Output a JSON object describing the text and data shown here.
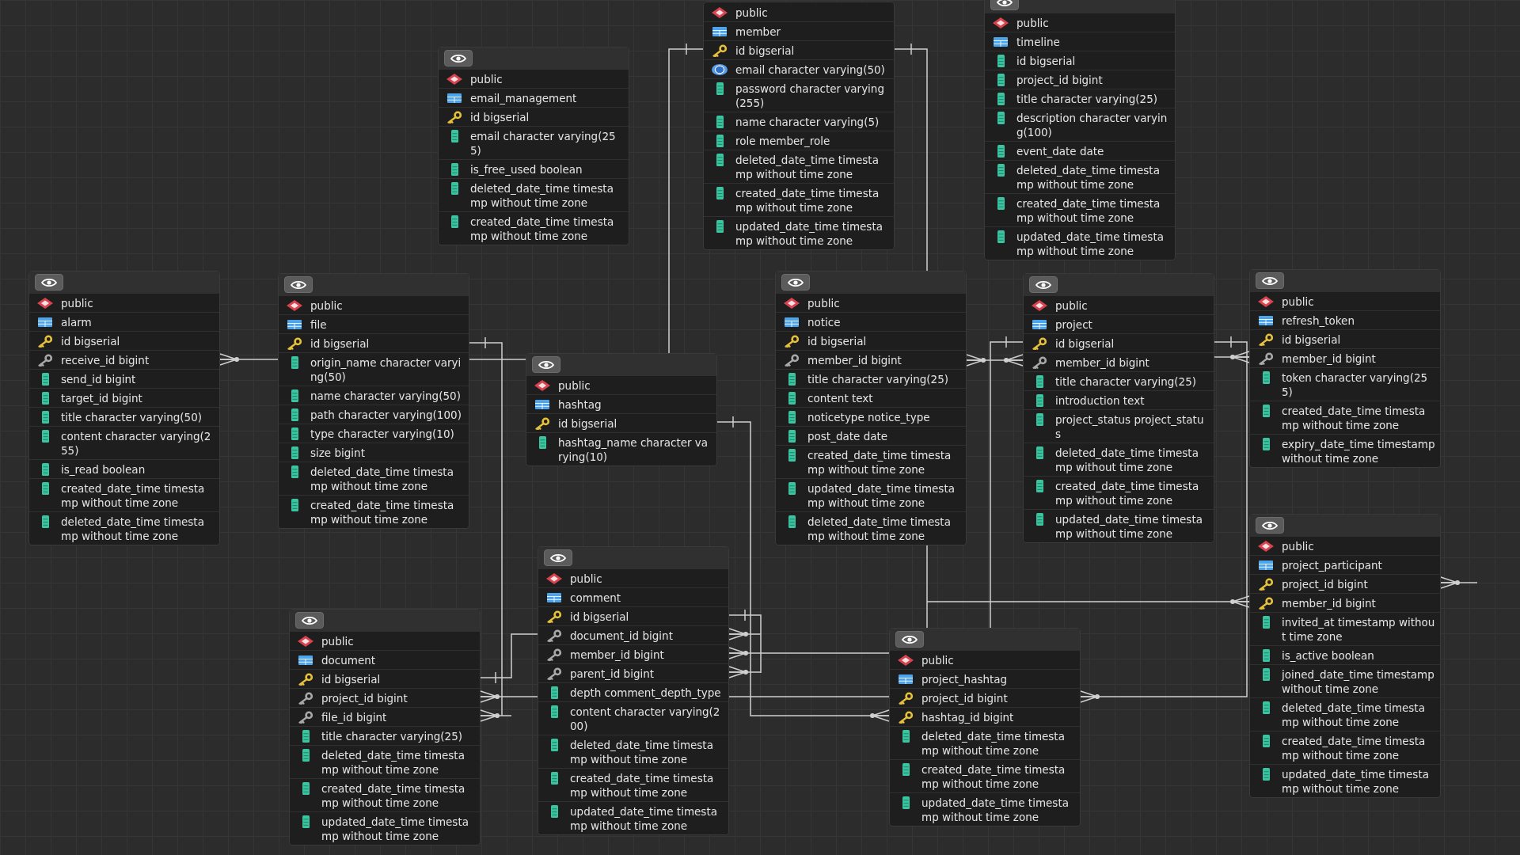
{
  "diagram": {
    "tables": [
      {
        "view_button": true,
        "schema": "public",
        "name": "email_management",
        "columns": [
          {
            "kind": "pk",
            "text": "id bigserial"
          },
          {
            "kind": "column",
            "text": "email character varying(255)"
          },
          {
            "kind": "column",
            "text": "is_free_used boolean"
          },
          {
            "kind": "column",
            "text": "deleted_date_time timestamp without time zone"
          },
          {
            "kind": "column",
            "text": "created_date_time timestamp without time zone"
          }
        ]
      },
      {
        "view_button": false,
        "schema": "public",
        "name": "member",
        "columns": [
          {
            "kind": "pk",
            "text": "id bigserial"
          },
          {
            "kind": "unique",
            "text": "email character varying(50)"
          },
          {
            "kind": "column",
            "text": "password character varying(255)"
          },
          {
            "kind": "column",
            "text": "name character varying(5)"
          },
          {
            "kind": "column",
            "text": "role member_role"
          },
          {
            "kind": "column",
            "text": "deleted_date_time timestamp without time zone"
          },
          {
            "kind": "column",
            "text": "created_date_time timestamp without time zone"
          },
          {
            "kind": "column",
            "text": "updated_date_time timestamp without time zone"
          }
        ]
      },
      {
        "view_button": true,
        "schema": "public",
        "name": "timeline",
        "columns": [
          {
            "kind": "column",
            "text": "id bigserial"
          },
          {
            "kind": "column",
            "text": "project_id bigint"
          },
          {
            "kind": "column",
            "text": "title character varying(25)"
          },
          {
            "kind": "column",
            "text": "description character varying(100)"
          },
          {
            "kind": "column",
            "text": "event_date date"
          },
          {
            "kind": "column",
            "text": "deleted_date_time timestamp without time zone"
          },
          {
            "kind": "column",
            "text": "created_date_time timestamp without time zone"
          },
          {
            "kind": "column",
            "text": "updated_date_time timestamp without time zone"
          }
        ]
      },
      {
        "view_button": true,
        "schema": "public",
        "name": "alarm",
        "columns": [
          {
            "kind": "pk",
            "text": "id bigserial"
          },
          {
            "kind": "fk",
            "text": "receive_id bigint"
          },
          {
            "kind": "column",
            "text": "send_id bigint"
          },
          {
            "kind": "column",
            "text": "target_id bigint"
          },
          {
            "kind": "column",
            "text": "title character varying(50)"
          },
          {
            "kind": "column",
            "text": "content character varying(255)"
          },
          {
            "kind": "column",
            "text": "is_read boolean"
          },
          {
            "kind": "column",
            "text": "created_date_time timestamp without time zone"
          },
          {
            "kind": "column",
            "text": "deleted_date_time timestamp without time zone"
          }
        ]
      },
      {
        "view_button": true,
        "schema": "public",
        "name": "file",
        "columns": [
          {
            "kind": "pk",
            "text": "id bigserial"
          },
          {
            "kind": "column",
            "text": "origin_name character varying(50)"
          },
          {
            "kind": "column",
            "text": "name character varying(50)"
          },
          {
            "kind": "column",
            "text": "path character varying(100)"
          },
          {
            "kind": "column",
            "text": "type character varying(10)"
          },
          {
            "kind": "column",
            "text": "size bigint"
          },
          {
            "kind": "column",
            "text": "deleted_date_time timestamp without time zone"
          },
          {
            "kind": "column",
            "text": "created_date_time timestamp without time zone"
          }
        ]
      },
      {
        "view_button": true,
        "schema": "public",
        "name": "hashtag",
        "columns": [
          {
            "kind": "pk",
            "text": "id bigserial"
          },
          {
            "kind": "column",
            "text": "hashtag_name character varying(10)"
          }
        ]
      },
      {
        "view_button": true,
        "schema": "public",
        "name": "notice",
        "columns": [
          {
            "kind": "pk",
            "text": "id bigserial"
          },
          {
            "kind": "fk",
            "text": "member_id bigint"
          },
          {
            "kind": "column",
            "text": "title character varying(25)"
          },
          {
            "kind": "column",
            "text": "content text"
          },
          {
            "kind": "column",
            "text": "noticetype notice_type"
          },
          {
            "kind": "column",
            "text": "post_date date"
          },
          {
            "kind": "column",
            "text": "created_date_time timestamp without time zone"
          },
          {
            "kind": "column",
            "text": "updated_date_time timestamp without time zone"
          },
          {
            "kind": "column",
            "text": "deleted_date_time timestamp without time zone"
          }
        ]
      },
      {
        "view_button": true,
        "schema": "public",
        "name": "project",
        "columns": [
          {
            "kind": "pk",
            "text": "id bigserial"
          },
          {
            "kind": "fk",
            "text": "member_id bigint"
          },
          {
            "kind": "column",
            "text": "title character varying(25)"
          },
          {
            "kind": "column",
            "text": "introduction text"
          },
          {
            "kind": "column",
            "text": "project_status project_status"
          },
          {
            "kind": "column",
            "text": "deleted_date_time timestamp without time zone"
          },
          {
            "kind": "column",
            "text": "created_date_time timestamp without time zone"
          },
          {
            "kind": "column",
            "text": "updated_date_time timestamp without time zone"
          }
        ]
      },
      {
        "view_button": true,
        "schema": "public",
        "name": "refresh_token",
        "columns": [
          {
            "kind": "pk",
            "text": "id bigserial"
          },
          {
            "kind": "fk",
            "text": "member_id bigint"
          },
          {
            "kind": "column",
            "text": "token character varying(255)"
          },
          {
            "kind": "column",
            "text": "created_date_time timestamp without time zone"
          },
          {
            "kind": "column",
            "text": "expiry_date_time timestamp without time zone"
          }
        ]
      },
      {
        "view_button": true,
        "schema": "public",
        "name": "document",
        "columns": [
          {
            "kind": "pk",
            "text": "id bigserial"
          },
          {
            "kind": "fk",
            "text": "project_id bigint"
          },
          {
            "kind": "fk",
            "text": "file_id bigint"
          },
          {
            "kind": "column",
            "text": "title character varying(25)"
          },
          {
            "kind": "column",
            "text": "deleted_date_time timestamp without time zone"
          },
          {
            "kind": "column",
            "text": "created_date_time timestamp without time zone"
          },
          {
            "kind": "column",
            "text": "updated_date_time timestamp without time zone"
          }
        ]
      },
      {
        "view_button": true,
        "schema": "public",
        "name": "comment",
        "columns": [
          {
            "kind": "pk",
            "text": "id bigserial"
          },
          {
            "kind": "fk",
            "text": "document_id bigint"
          },
          {
            "kind": "fk",
            "text": "member_id bigint"
          },
          {
            "kind": "fk",
            "text": "parent_id bigint"
          },
          {
            "kind": "column",
            "text": "depth comment_depth_type"
          },
          {
            "kind": "column",
            "text": "content character varying(200)"
          },
          {
            "kind": "column",
            "text": "deleted_date_time timestamp without time zone"
          },
          {
            "kind": "column",
            "text": "created_date_time timestamp without time zone"
          },
          {
            "kind": "column",
            "text": "updated_date_time timestamp without time zone"
          }
        ]
      },
      {
        "view_button": true,
        "schema": "public",
        "name": "project_hashtag",
        "columns": [
          {
            "kind": "pk",
            "text": "project_id bigint"
          },
          {
            "kind": "pk",
            "text": "hashtag_id bigint"
          },
          {
            "kind": "column",
            "text": "deleted_date_time timestamp without time zone"
          },
          {
            "kind": "column",
            "text": "created_date_time timestamp without time zone"
          },
          {
            "kind": "column",
            "text": "updated_date_time timestamp without time zone"
          }
        ]
      },
      {
        "view_button": true,
        "schema": "public",
        "name": "project_participant",
        "columns": [
          {
            "kind": "pk",
            "text": "project_id bigint"
          },
          {
            "kind": "pk",
            "text": "member_id bigint"
          },
          {
            "kind": "column",
            "text": "invited_at timestamp without time zone"
          },
          {
            "kind": "column",
            "text": "is_active boolean"
          },
          {
            "kind": "column",
            "text": "joined_date_time timestamp without time zone"
          },
          {
            "kind": "column",
            "text": "deleted_date_time timestamp without time zone"
          },
          {
            "kind": "column",
            "text": "created_date_time timestamp without time zone"
          },
          {
            "kind": "column",
            "text": "updated_date_time timestamp without time zone"
          }
        ]
      }
    ]
  }
}
